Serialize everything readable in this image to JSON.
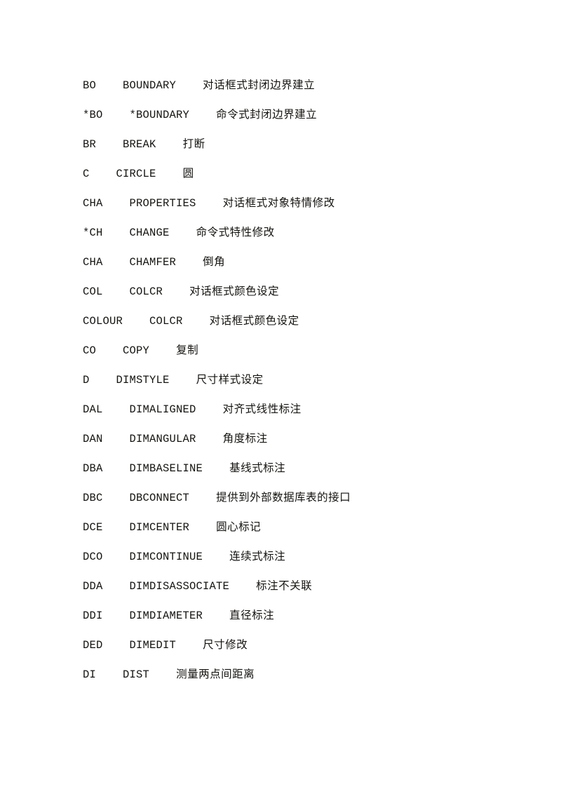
{
  "document": {
    "type": "scanned-text-page",
    "language": "zh-CN",
    "background_color": "#ffffff",
    "text_color": "#14130f",
    "rows": [
      {
        "abbr": "BO",
        "gap1": "    ",
        "command": "BOUNDARY",
        "gap2": "    ",
        "description": "对话框式封闭边界建立"
      },
      {
        "abbr": "*BO",
        "gap1": "    ",
        "command": "*BOUNDARY",
        "gap2": "    ",
        "description": "命令式封闭边界建立"
      },
      {
        "abbr": "BR",
        "gap1": "    ",
        "command": "BREAK",
        "gap2": "    ",
        "description": "打断"
      },
      {
        "abbr": "C",
        "gap1": "    ",
        "command": "CIRCLE",
        "gap2": "    ",
        "description": "圆"
      },
      {
        "abbr": "CHA",
        "gap1": "    ",
        "command": "PROPERTIES",
        "gap2": "    ",
        "description": "对话框式对象特情修改"
      },
      {
        "abbr": "*CH",
        "gap1": "    ",
        "command": "CHANGE",
        "gap2": "    ",
        "description": "命令式特性修改"
      },
      {
        "abbr": "CHA",
        "gap1": "    ",
        "command": "CHAMFER",
        "gap2": "    ",
        "description": "倒角"
      },
      {
        "abbr": "COL",
        "gap1": "    ",
        "command": "COLCR",
        "gap2": "    ",
        "description": "对话框式颜色设定"
      },
      {
        "abbr": "COLOUR",
        "gap1": "    ",
        "command": "COLCR",
        "gap2": "    ",
        "description": "对话框式颜色设定"
      },
      {
        "abbr": "CO",
        "gap1": "    ",
        "command": "COPY",
        "gap2": "    ",
        "description": "复制"
      },
      {
        "abbr": "D",
        "gap1": "    ",
        "command": "DIMSTYLE",
        "gap2": "    ",
        "description": "尺寸样式设定"
      },
      {
        "abbr": "DAL",
        "gap1": "    ",
        "command": "DIMALIGNED",
        "gap2": "    ",
        "description": "对齐式线性标注"
      },
      {
        "abbr": "DAN",
        "gap1": "    ",
        "command": "DIMANGULAR",
        "gap2": "    ",
        "description": "角度标注"
      },
      {
        "abbr": "DBA",
        "gap1": "    ",
        "command": "DIMBASELINE",
        "gap2": "    ",
        "description": "基线式标注"
      },
      {
        "abbr": "DBC",
        "gap1": "    ",
        "command": "DBCONNECT",
        "gap2": "    ",
        "description": "提供到外部数据库表的接口"
      },
      {
        "abbr": "DCE",
        "gap1": "    ",
        "command": "DIMCENTER",
        "gap2": "    ",
        "description": "圆心标记"
      },
      {
        "abbr": "DCO",
        "gap1": "    ",
        "command": "DIMCONTINUE",
        "gap2": "    ",
        "description": "连续式标注"
      },
      {
        "abbr": "DDA",
        "gap1": "    ",
        "command": "DIMDISASSOCIATE",
        "gap2": "    ",
        "description": "标注不关联"
      },
      {
        "abbr": "DDI",
        "gap1": "    ",
        "command": "DIMDIAMETER",
        "gap2": "    ",
        "description": "直径标注"
      },
      {
        "abbr": "DED",
        "gap1": "    ",
        "command": "DIMEDIT",
        "gap2": "    ",
        "description": "尺寸修改"
      },
      {
        "abbr": "DI",
        "gap1": "    ",
        "command": "DIST",
        "gap2": "    ",
        "description": "测量两点间距离"
      }
    ]
  }
}
